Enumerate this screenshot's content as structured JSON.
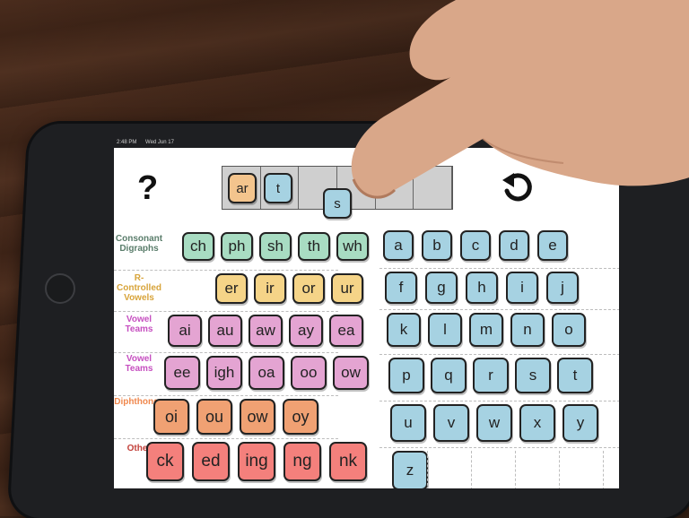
{
  "status_bar": {
    "time": "2:48 PM",
    "date": "Wed Jun 17"
  },
  "toolbar": {
    "help_label": "?"
  },
  "word_tray": {
    "slots": 6,
    "tiles": [
      "ar",
      "t",
      "s"
    ]
  },
  "row_labels": {
    "consonant_digraphs": "Consonant Digraphs",
    "r_controlled": "R-Controlled Vowels",
    "vowel_teams_1": "Vowel Teams",
    "vowel_teams_2": "Vowel Teams",
    "diphthongs": "Diphthongs",
    "other": "Other"
  },
  "row_label_colors": {
    "consonant_digraphs": "#5a7d6b",
    "r_controlled": "#d8a43a",
    "vowel_teams": "#c64fc0",
    "diphthongs": "#f0884e",
    "other": "#c2403a"
  },
  "tiles": {
    "consonant_digraphs": [
      "ch",
      "ph",
      "sh",
      "th",
      "wh"
    ],
    "r_controlled": [
      "er",
      "ir",
      "or",
      "ur"
    ],
    "vowel_teams_1": [
      "ai",
      "au",
      "aw",
      "ay",
      "ea"
    ],
    "vowel_teams_2": [
      "ee",
      "igh",
      "oa",
      "oo",
      "ow"
    ],
    "diphthongs": [
      "oi",
      "ou",
      "ow",
      "oy"
    ],
    "other": [
      "ck",
      "ed",
      "ing",
      "ng",
      "nk"
    ],
    "letters": [
      "a",
      "b",
      "c",
      "d",
      "e",
      "f",
      "g",
      "h",
      "i",
      "j",
      "k",
      "l",
      "m",
      "n",
      "o",
      "p",
      "q",
      "r",
      "s",
      "t",
      "u",
      "v",
      "w",
      "x",
      "y",
      "z"
    ]
  },
  "colors": {
    "tray_tile_orange": "#f3c48d",
    "letter_blue": "#a6d2e2",
    "digraph_green": "#a8dcc2",
    "r_controlled_yellow": "#f5d488",
    "vowel_team_pink": "#e4a4d2",
    "diphthong_coral": "#f0a173",
    "other_red": "#f4807c"
  },
  "icons": {
    "undo": "undo-arrow-icon",
    "help": "question-mark-icon"
  }
}
